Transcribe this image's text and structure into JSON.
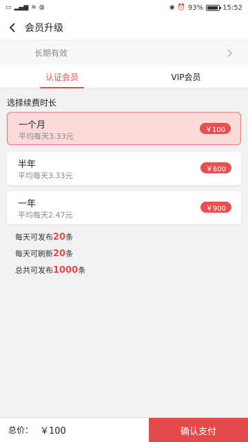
{
  "status_bar": {
    "left_icons": [
      "HD",
      "4G",
      "wifi",
      "data"
    ],
    "right_icons": [
      "eye",
      "alarm"
    ],
    "battery": "93%",
    "battery_level": 0.93,
    "time": "15:52"
  },
  "nav": {
    "title": "会员升级"
  },
  "validity": {
    "text": "长期有效"
  },
  "tabs": [
    {
      "label": "认证会员",
      "active": true
    },
    {
      "label": "VIP会员",
      "active": false
    }
  ],
  "section_title": "选择续费时长",
  "plans": [
    {
      "name": "一个月",
      "sub": "平均每天3.33元",
      "price": "￥100",
      "selected": true
    },
    {
      "name": "半年",
      "sub": "平均每天3.33元",
      "price": "￥600",
      "selected": false
    },
    {
      "name": "一年",
      "sub": "平均每天2.47元",
      "price": "￥900",
      "selected": false
    }
  ],
  "benefits": [
    {
      "pre": "每天可发布",
      "num": "20",
      "post": "条"
    },
    {
      "pre": "每天可刷新",
      "num": "20",
      "post": "条"
    },
    {
      "pre": "总共可发布",
      "num": "1000",
      "post": "条"
    }
  ],
  "footer": {
    "total_label": "总价：",
    "total_price": "￥100",
    "pay_label": "确认支付"
  },
  "colors": {
    "accent": "#e54a4a",
    "selected_bg": "#fbd9d9"
  }
}
